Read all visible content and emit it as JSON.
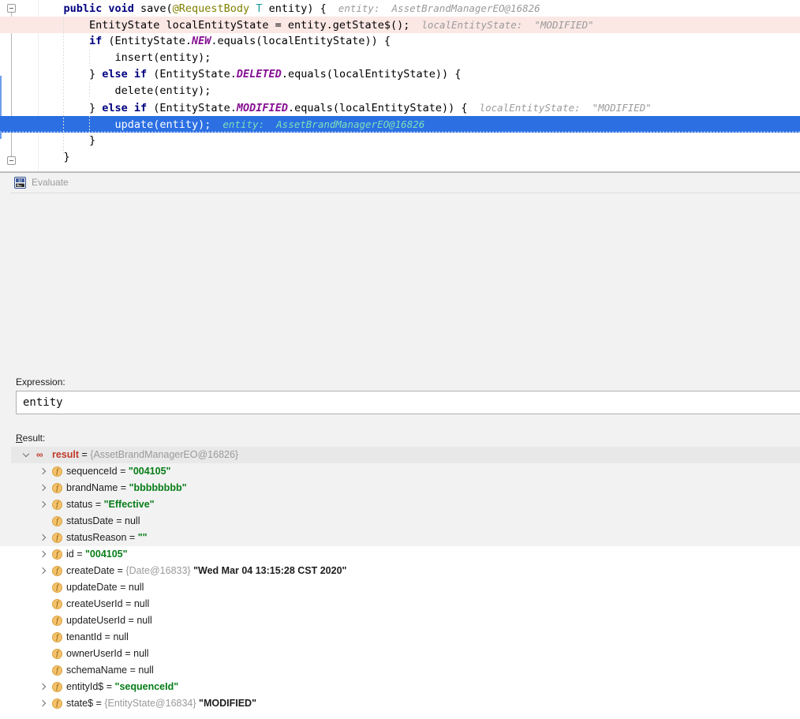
{
  "editor": {
    "lines": [
      {
        "indent": 1,
        "tokens": [
          {
            "t": "public ",
            "c": "kw"
          },
          {
            "t": "void ",
            "c": "kw"
          },
          {
            "t": "save(",
            "c": "plain"
          },
          {
            "t": "@RequestBody ",
            "c": "anno"
          },
          {
            "t": "T",
            "c": "type-t"
          },
          {
            "t": " entity) {",
            "c": "plain"
          }
        ],
        "hint": "entity:  AssetBrandManagerEO@16826",
        "highlight": "none"
      },
      {
        "indent": 2,
        "tokens": [
          {
            "t": "EntityState localEntityState = entity.getState$();",
            "c": "plain"
          }
        ],
        "hint": "localEntityState:  \"MODIFIED\"",
        "highlight": "pink"
      },
      {
        "indent": 2,
        "tokens": [
          {
            "t": "if ",
            "c": "kw"
          },
          {
            "t": "(EntityState.",
            "c": "plain"
          },
          {
            "t": "NEW",
            "c": "enum-c"
          },
          {
            "t": ".equals(localEntityState)) {",
            "c": "plain"
          }
        ],
        "hint": "",
        "highlight": "none"
      },
      {
        "indent": 3,
        "tokens": [
          {
            "t": "insert(entity);",
            "c": "plain"
          }
        ],
        "hint": "",
        "highlight": "none"
      },
      {
        "indent": 2,
        "tokens": [
          {
            "t": "} ",
            "c": "plain"
          },
          {
            "t": "else if ",
            "c": "kw"
          },
          {
            "t": "(EntityState.",
            "c": "plain"
          },
          {
            "t": "DELETED",
            "c": "enum-c"
          },
          {
            "t": ".equals(localEntityState)) {",
            "c": "plain"
          }
        ],
        "hint": "",
        "highlight": "none"
      },
      {
        "indent": 3,
        "tokens": [
          {
            "t": "delete(entity);",
            "c": "plain"
          }
        ],
        "hint": "",
        "highlight": "none"
      },
      {
        "indent": 2,
        "tokens": [
          {
            "t": "} ",
            "c": "plain"
          },
          {
            "t": "else if ",
            "c": "kw"
          },
          {
            "t": "(EntityState.",
            "c": "plain"
          },
          {
            "t": "MODIFIED",
            "c": "enum-c"
          },
          {
            "t": ".equals(localEntityState)) {",
            "c": "plain"
          }
        ],
        "hint": "localEntityState:  \"MODIFIED\"",
        "highlight": "none"
      },
      {
        "indent": 3,
        "tokens": [
          {
            "t": "update(entity);",
            "c": "sel-text"
          }
        ],
        "hint": "entity:  AssetBrandManagerEO@16826",
        "highlight": "blue"
      },
      {
        "indent": 2,
        "tokens": [
          {
            "t": "}",
            "c": "plain"
          }
        ],
        "hint": "",
        "highlight": "none"
      },
      {
        "indent": 1,
        "tokens": [
          {
            "t": "}",
            "c": "plain"
          }
        ],
        "hint": "",
        "highlight": "none"
      }
    ]
  },
  "dialog": {
    "title": "Evaluate",
    "icon": "evaluate-expression-icon",
    "expression_label": "Expression:",
    "expression_value": "entity",
    "result_label": "Result:",
    "result_underline_char": "R"
  },
  "result_tree": {
    "root": {
      "name": "result",
      "ref": "{AssetBrandManagerEO@16826}",
      "expanded": true,
      "icon": "result-glasses-icon"
    },
    "rows": [
      {
        "expandable": true,
        "icon": "field-icon",
        "name": "sequenceId",
        "ref": "",
        "value": "\"004105\"",
        "vtype": "string"
      },
      {
        "expandable": true,
        "icon": "field-icon",
        "name": "brandName",
        "ref": "",
        "value": "\"bbbbbbbb\"",
        "vtype": "string"
      },
      {
        "expandable": true,
        "icon": "field-icon",
        "name": "status",
        "ref": "",
        "value": "\"Effective\"",
        "vtype": "string"
      },
      {
        "expandable": false,
        "icon": "field-icon",
        "name": "statusDate",
        "ref": "",
        "value": "null",
        "vtype": "null"
      },
      {
        "expandable": true,
        "icon": "field-icon",
        "name": "statusReason",
        "ref": "",
        "value": "\"\"",
        "vtype": "string"
      },
      {
        "expandable": true,
        "icon": "field-icon",
        "name": "id",
        "ref": "",
        "value": "\"004105\"",
        "vtype": "string"
      },
      {
        "expandable": true,
        "icon": "field-icon",
        "name": "createDate",
        "ref": "{Date@16833}",
        "value": "\"Wed Mar 04 13:15:28 CST 2020\"",
        "vtype": "plain"
      },
      {
        "expandable": false,
        "icon": "field-icon",
        "name": "updateDate",
        "ref": "",
        "value": "null",
        "vtype": "null"
      },
      {
        "expandable": false,
        "icon": "field-icon",
        "name": "createUserId",
        "ref": "",
        "value": "null",
        "vtype": "null"
      },
      {
        "expandable": false,
        "icon": "field-icon",
        "name": "updateUserId",
        "ref": "",
        "value": "null",
        "vtype": "null"
      },
      {
        "expandable": false,
        "icon": "field-icon",
        "name": "tenantId",
        "ref": "",
        "value": "null",
        "vtype": "null"
      },
      {
        "expandable": false,
        "icon": "field-icon",
        "name": "ownerUserId",
        "ref": "",
        "value": "null",
        "vtype": "null"
      },
      {
        "expandable": false,
        "icon": "field-icon",
        "name": "schemaName",
        "ref": "",
        "value": "null",
        "vtype": "null"
      },
      {
        "expandable": true,
        "icon": "field-icon",
        "name": "entityId$",
        "ref": "",
        "value": "\"sequenceId\"",
        "vtype": "string"
      },
      {
        "expandable": true,
        "icon": "field-icon",
        "name": "state$",
        "ref": "{EntityState@16834}",
        "value": "\"MODIFIED\"",
        "vtype": "plain"
      }
    ]
  },
  "colors": {
    "keyword": "#000080",
    "annotation": "#808000",
    "enum_constant": "#871094",
    "inline_hint": "#9a9a9a",
    "selection_blue": "#2b6fe3",
    "execution_pink": "#fbe8e5",
    "string_green": "#067d17",
    "type_teal": "#20999d"
  }
}
